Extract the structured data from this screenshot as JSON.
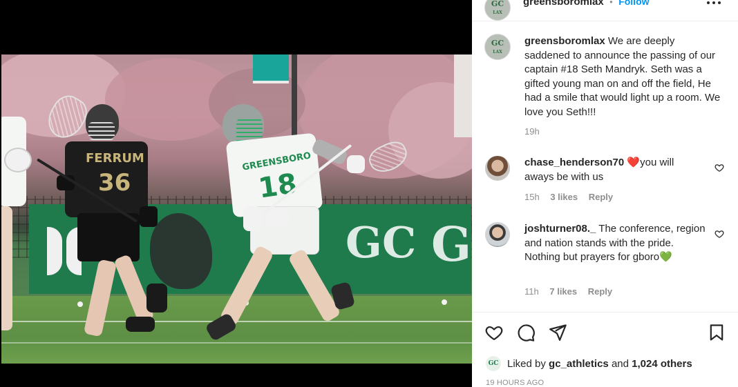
{
  "header": {
    "username": "greensboromlax",
    "separator": "•",
    "follow_label": "Follow"
  },
  "caption": {
    "username": "greensboromlax",
    "text": "We are deeply saddened to announce the passing of our captain #18 Seth Mandryk. Seth was a gifted young man on and off the field, He had a smile that would light up a room. We love you Seth!!!",
    "time": "19h"
  },
  "comments": [
    {
      "username": "chase_henderson70",
      "emoji": "❤️",
      "text": "you will aways be with us",
      "time": "15h",
      "likes": "3 likes",
      "reply_label": "Reply"
    },
    {
      "username": "joshturner08._",
      "text": "The conference, region and nation stands with the pride. Nothing but prayers for gboro",
      "emoji": "💚",
      "time": "11h",
      "likes": "7 likes",
      "reply_label": "Reply"
    }
  ],
  "actions": {
    "like_icon": "heart-outline-icon",
    "comment_icon": "comment-bubble-icon",
    "share_icon": "paper-plane-icon",
    "save_icon": "bookmark-icon"
  },
  "likes": {
    "prefix": "Liked by",
    "user": "gc_athletics",
    "conjunction": "and",
    "count": "1,024 others"
  },
  "timestamp": "19 HOURS AGO",
  "photo": {
    "jersey_left_text": "FERRUM",
    "jersey_left_number": "36",
    "jersey_right_text": "GREENSBORO",
    "jersey_right_number": "18",
    "banner_text_1": "GC",
    "banner_text_2": "G"
  },
  "colors": {
    "link_blue": "#0095f6",
    "muted": "#8e8e8e",
    "team_green": "#1f7a4c",
    "heart_red": "#e0245e",
    "heart_green": "#2ec23a"
  }
}
